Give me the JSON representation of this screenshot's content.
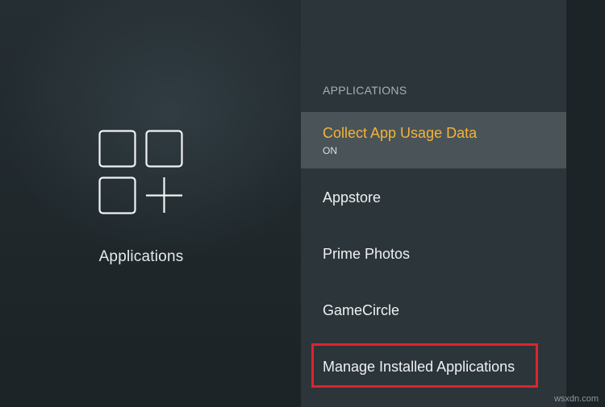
{
  "category": {
    "title": "Applications",
    "icon": "applications-grid-icon"
  },
  "settings_menu": {
    "section_header": "APPLICATIONS",
    "items": [
      {
        "label": "Collect App Usage Data",
        "sublabel": "ON",
        "selected": true
      },
      {
        "label": "Appstore"
      },
      {
        "label": "Prime Photos"
      },
      {
        "label": "GameCircle"
      },
      {
        "label": "Manage Installed Applications",
        "highlighted": true
      }
    ]
  },
  "colors": {
    "selected_text": "#f4b33a",
    "highlight_border": "#e0232b",
    "panel_bg": "#2c353a",
    "selected_bg": "#4a5458"
  },
  "watermark": "wsxdn.com"
}
